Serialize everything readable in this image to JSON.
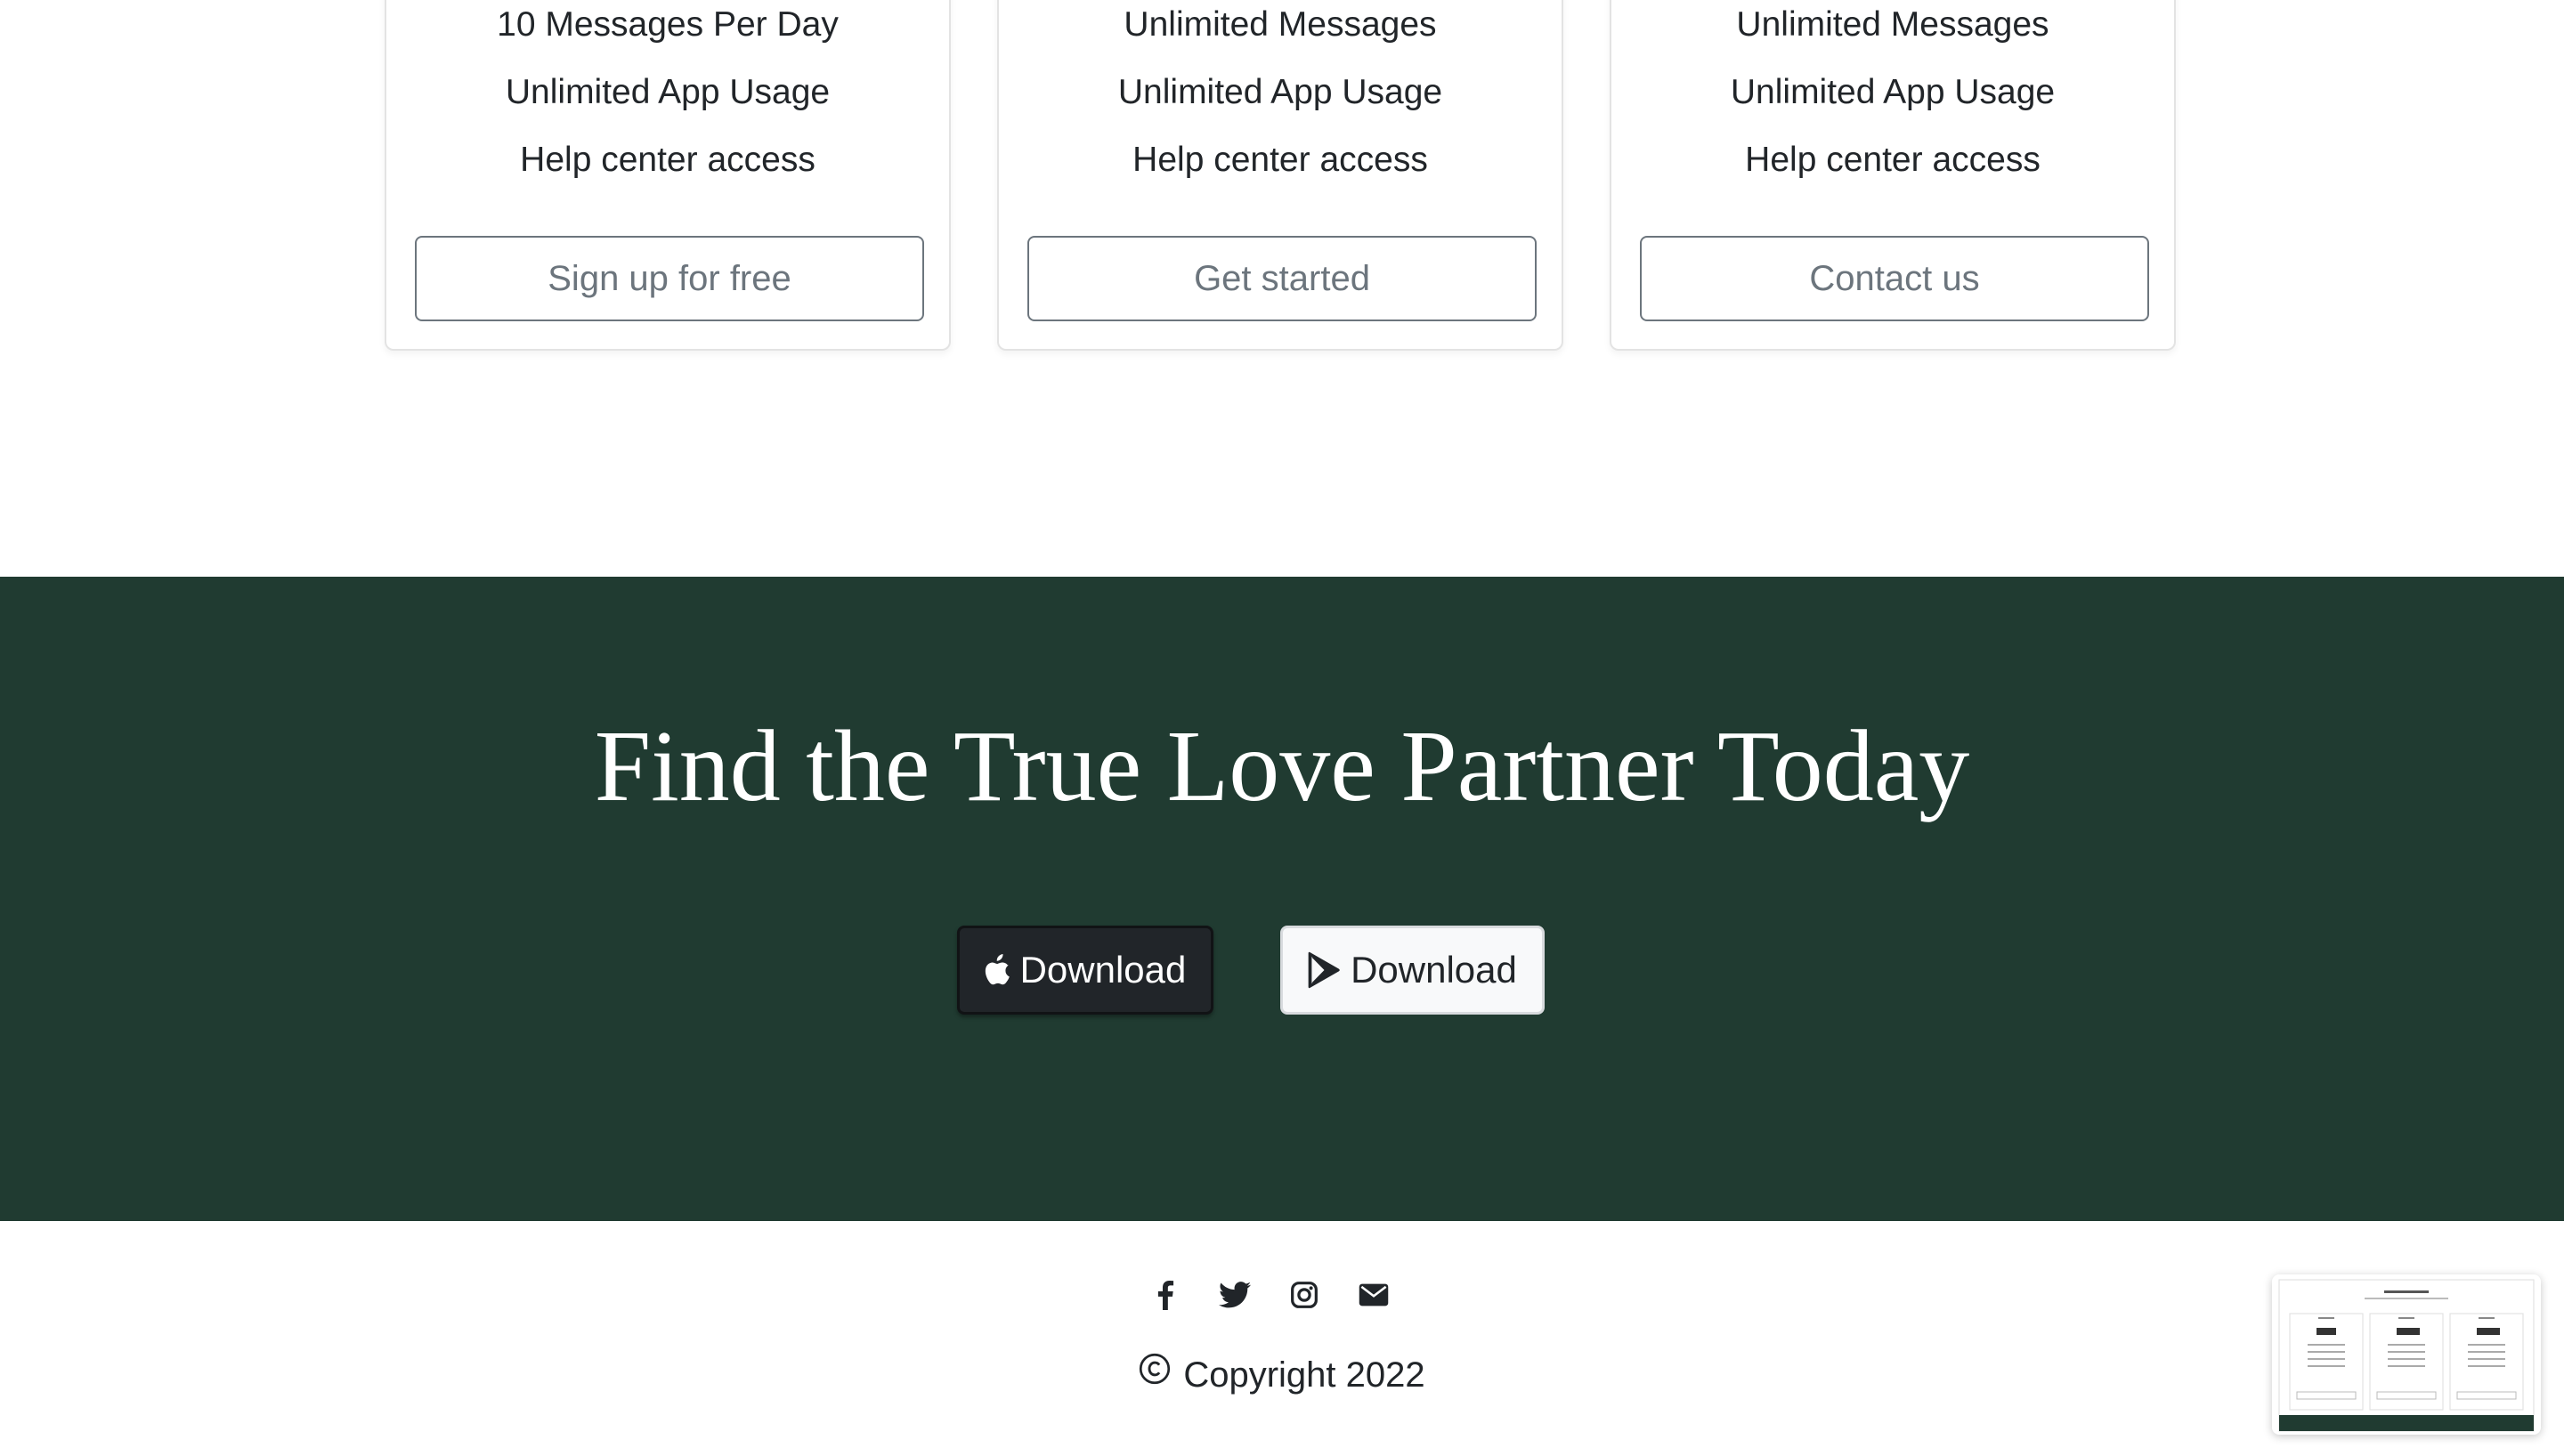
{
  "plans": [
    {
      "features": [
        "10 Messages Per Day",
        "Unlimited App Usage",
        "Help center access"
      ],
      "button_label": "Sign up for free"
    },
    {
      "features": [
        "Unlimited Messages",
        "Unlimited App Usage",
        "Help center access"
      ],
      "button_label": "Get started"
    },
    {
      "features": [
        "Unlimited Messages",
        "Unlimited App Usage",
        "Help center access"
      ],
      "button_label": "Contact us"
    }
  ],
  "cta": {
    "title": "Find the True Love Partner Today",
    "apple_button_label": "Download",
    "play_button_label": "Download",
    "apple_icon": "apple-icon",
    "play_icon": "google-play-icon"
  },
  "footer": {
    "social_icons": [
      "facebook-icon",
      "twitter-icon",
      "instagram-icon",
      "envelope-icon"
    ],
    "copyright": "Copyright 2022",
    "copyright_icon": "copyright-icon"
  },
  "colors": {
    "cta_background": "#203b31",
    "outline_button": "#6c757d",
    "dark_button": "#212529",
    "light_button": "#f8f9fa",
    "text": "#212529"
  }
}
